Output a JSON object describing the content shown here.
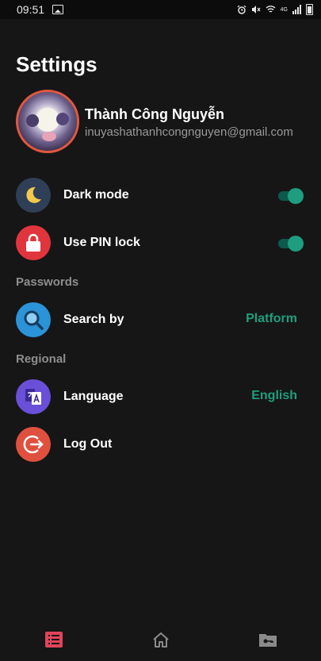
{
  "status_bar": {
    "time": "09:51",
    "network_label": "4G",
    "icons": [
      "gallery-icon",
      "alarm-icon",
      "mute-icon",
      "wifi-icon",
      "signal-icon",
      "battery-icon"
    ]
  },
  "page": {
    "title": "Settings"
  },
  "profile": {
    "name": "Thành Công Nguyễn",
    "email": "inuyashathanhcongnguyen@gmail.com"
  },
  "settings": {
    "dark_mode": {
      "label": "Dark mode",
      "enabled": true,
      "icon": "moon-icon",
      "icon_bg": "#2f3f57"
    },
    "pin_lock": {
      "label": "Use PIN lock",
      "enabled": true,
      "icon": "lock-icon",
      "icon_bg": "#e0353d"
    }
  },
  "sections": {
    "passwords": {
      "title": "Passwords",
      "search_by": {
        "label": "Search by",
        "value": "Platform",
        "icon": "search-icon",
        "icon_bg": "#2b93d8"
      }
    },
    "regional": {
      "title": "Regional",
      "language": {
        "label": "Language",
        "value": "English",
        "icon": "translate-icon",
        "icon_bg": "#6a4fd8"
      }
    }
  },
  "logout": {
    "label": "Log Out",
    "icon": "logout-icon",
    "icon_bg": "#e0503e"
  },
  "bottom_nav": {
    "items": [
      {
        "name": "list-icon",
        "active": true
      },
      {
        "name": "home-icon",
        "active": false
      },
      {
        "name": "folder-key-icon",
        "active": false
      }
    ]
  },
  "colors": {
    "background": "#161616",
    "accent": "#1e9e7e",
    "nav_active": "#e0445a",
    "nav_inactive": "#8a8a8a",
    "muted_text": "#8e8e8e"
  }
}
